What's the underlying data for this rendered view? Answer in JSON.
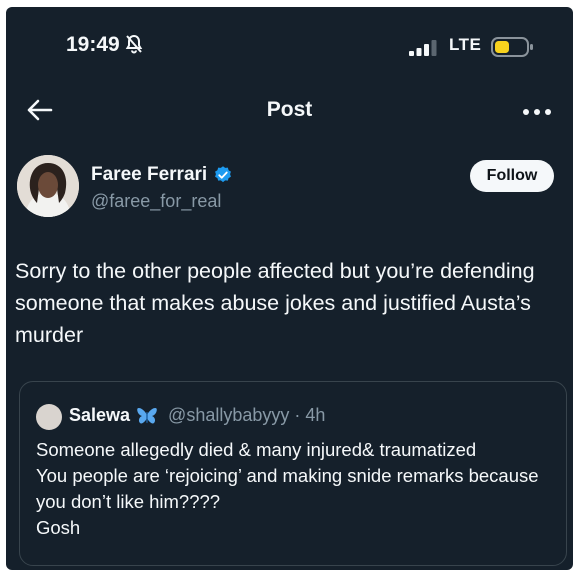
{
  "status_bar": {
    "time": "19:49",
    "network": "LTE",
    "icons": [
      "bell-muted-icon",
      "signal-icon",
      "battery-icon"
    ]
  },
  "header": {
    "title": "Post",
    "back_icon": "arrow-left-icon",
    "more_icon": "more-horizontal-icon"
  },
  "author": {
    "name": "Faree Ferrari",
    "handle": "@faree_for_real",
    "verified_icon": "verified-badge-icon",
    "follow_label": "Follow"
  },
  "post": {
    "text": "Sorry to the other people affected but you’re defending someone that makes abuse jokes and justified Austa’s murder"
  },
  "quoted_post": {
    "name": "Salewa",
    "name_emoji": "butterfly-icon",
    "meta": "@shallybabyyy · 4h",
    "text": "Someone allegedly died & many injured&  traumatized\nYou people are ‘rejoicing’ and making snide remarks because you don’t like him????\nGosh"
  },
  "colors": {
    "background": "#15202b",
    "text": "#f5f8fa",
    "secondary_text": "#8899a6",
    "accent": "#1d9bf0",
    "border": "#38444d"
  }
}
